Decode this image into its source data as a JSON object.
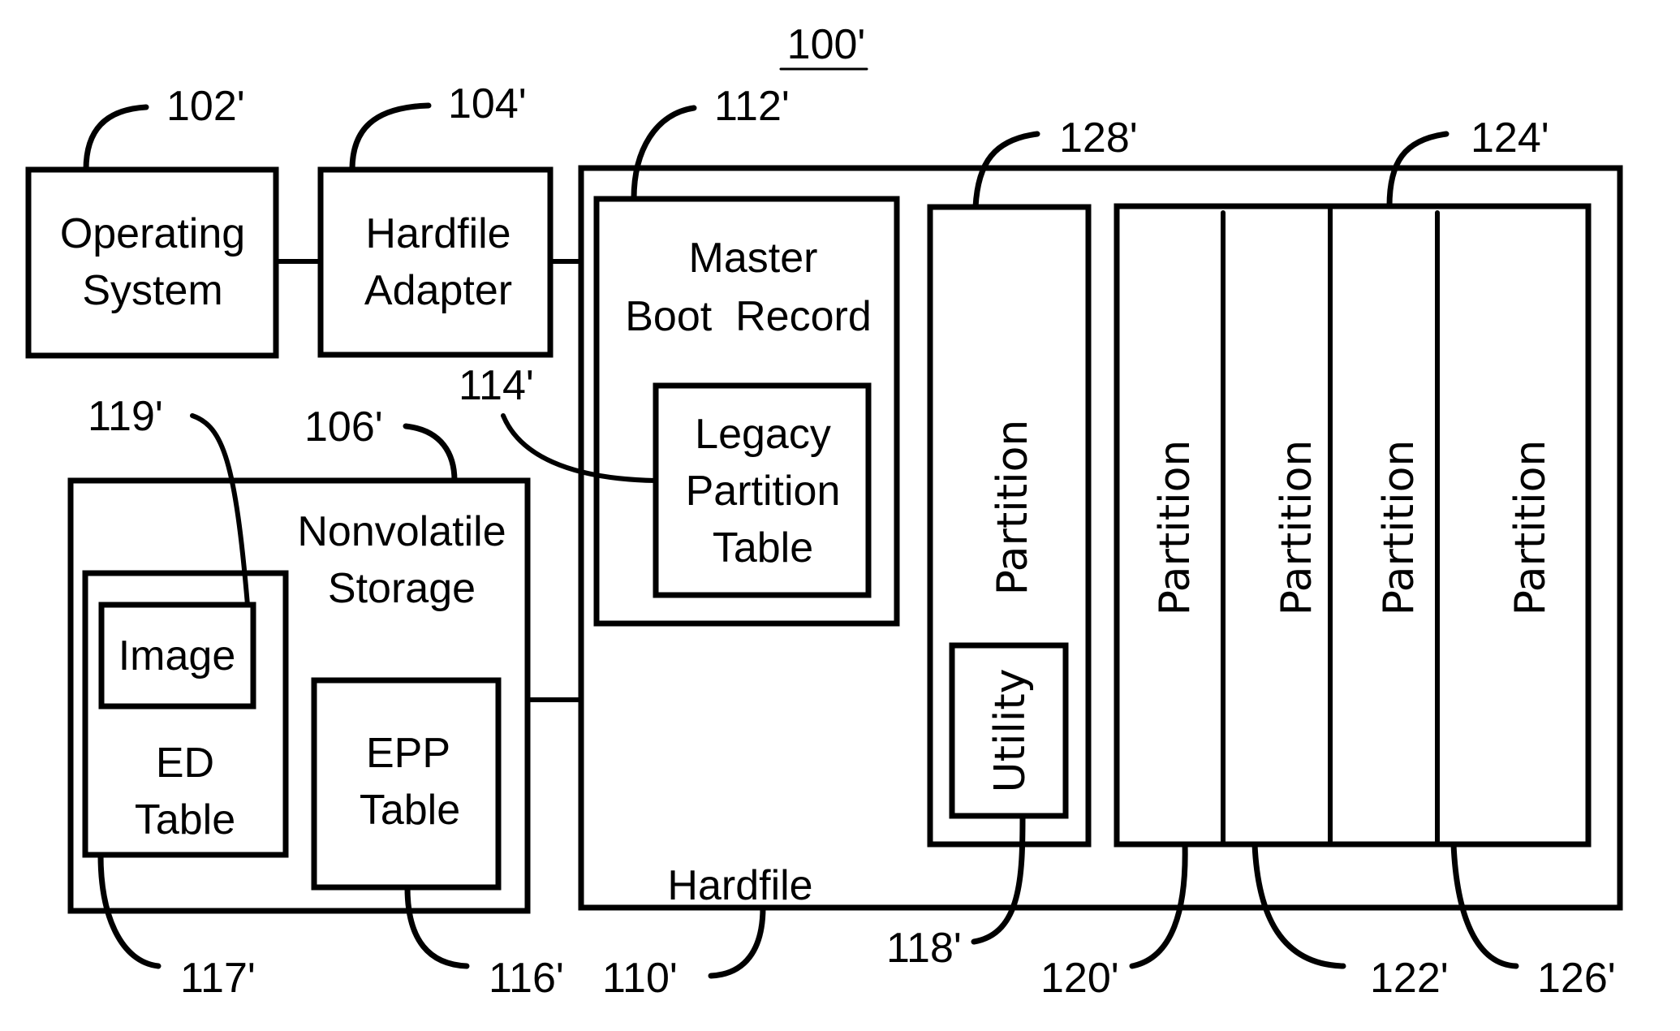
{
  "figure": {
    "number": "100'"
  },
  "blocks": {
    "operating_system": {
      "line1": "Operating",
      "line2": "System",
      "ref": "102'"
    },
    "hardfile_adapter": {
      "line1": "Hardfile",
      "line2": "Adapter",
      "ref": "104'"
    },
    "nonvolatile_storage": {
      "line1": "Nonvolatile",
      "line2": "Storage",
      "ref": "106'"
    },
    "hardfile": {
      "label": "Hardfile",
      "ref": "110'"
    },
    "master_boot_record": {
      "line1": "Master",
      "line2": "Boot  Record",
      "ref": "112'"
    },
    "legacy_partition_table": {
      "line1": "Legacy",
      "line2": "Partition",
      "line3": "Table",
      "ref": "114'"
    },
    "epp_table": {
      "line1": "EPP",
      "line2": "Table",
      "ref": "116'"
    },
    "ed_table": {
      "line1": "ED",
      "line2": "Table",
      "ref": "117'"
    },
    "utility": {
      "label": "Utility",
      "ref": "118'"
    },
    "image": {
      "label": "Image",
      "ref": "119'"
    },
    "partition_128": {
      "label": "Partition",
      "ref": "128'"
    },
    "partition_group": {
      "ref": "124'"
    },
    "partitions": [
      {
        "label": "Partition",
        "ref": "120'"
      },
      {
        "label": "Partition",
        "ref": "122'"
      },
      {
        "label": "Partition",
        "ref": ""
      },
      {
        "label": "Partition",
        "ref": "126'"
      }
    ]
  }
}
